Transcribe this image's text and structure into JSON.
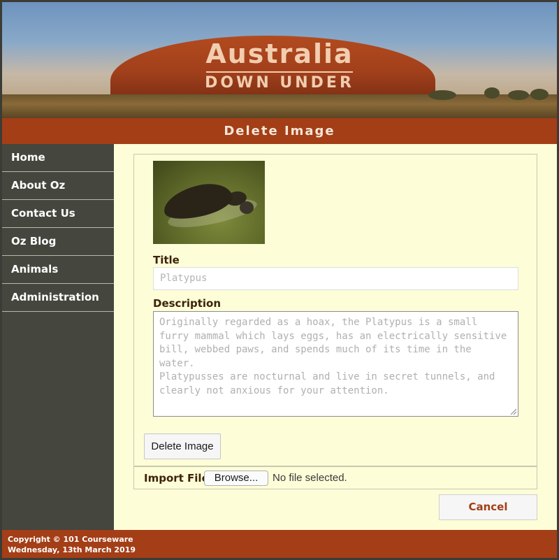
{
  "banner": {
    "title": "Australia",
    "subtitle": "DOWN UNDER"
  },
  "page": {
    "heading": "Delete Image"
  },
  "sidebar": {
    "items": [
      {
        "label": "Home"
      },
      {
        "label": "About Oz"
      },
      {
        "label": "Contact Us"
      },
      {
        "label": "Oz Blog"
      },
      {
        "label": "Animals"
      },
      {
        "label": "Administration"
      }
    ]
  },
  "form": {
    "title_label": "Title",
    "title_value": "Platypus",
    "description_label": "Description",
    "description_value": "Originally regarded as a hoax, the Platypus is a small furry mammal which lays eggs, has an electrically sensitive bill, webbed paws, and spends much of its time in the water.\nPlatypusses are nocturnal and live in secret tunnels, and clearly not anxious for your attention.",
    "delete_button": "Delete Image",
    "import_label": "Import File",
    "browse_button": "Browse...",
    "file_status": "No file selected.",
    "cancel_button": "Cancel"
  },
  "footer": {
    "copyright": "Copyright © 101 Courseware",
    "date": "Wednesday, 13th March 2019"
  },
  "colors": {
    "brand": "#a33e17",
    "sidebar": "#45463e",
    "content_bg": "#fdfdd8"
  }
}
